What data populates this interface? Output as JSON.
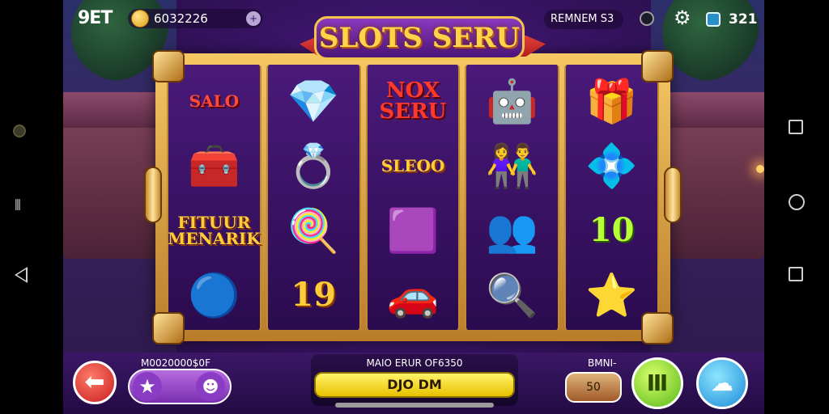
{
  "topbar": {
    "brand": "9ET",
    "balance": "6032226",
    "add": "+",
    "status_text": "REMNEM S3",
    "counter": "321"
  },
  "title": "SLOTS SERU",
  "reels": [
    [
      {
        "kind": "text",
        "text": "SALO",
        "style": "red",
        "name": "character-boy-symbol"
      },
      {
        "kind": "icon",
        "icon": "treasure-chest-icon",
        "glyph": "🧰"
      },
      {
        "kind": "text",
        "text": "FITUUR\nMENARIK",
        "style": "gold",
        "name": "fitur-menarik-symbol"
      },
      {
        "kind": "icon",
        "icon": "blue-orb-icon",
        "glyph": "🔵"
      }
    ],
    [
      {
        "kind": "icon",
        "icon": "blue-gem-icon",
        "glyph": "💎"
      },
      {
        "kind": "icon",
        "icon": "gold-ring-icon",
        "glyph": "💍"
      },
      {
        "kind": "icon",
        "icon": "lollipop-icon",
        "glyph": "🍭"
      },
      {
        "kind": "text",
        "text": "19",
        "style": "gold big",
        "name": "number-19-symbol"
      }
    ],
    [
      {
        "kind": "text",
        "text": "NOX\nSERU",
        "style": "redgold",
        "name": "nox-seru-symbol"
      },
      {
        "kind": "text",
        "text": "SLEOO",
        "style": "gold",
        "name": "sleoo-bonus-symbol"
      },
      {
        "kind": "icon",
        "icon": "purple-gem-icon",
        "glyph": "🟪"
      },
      {
        "kind": "icon",
        "icon": "toy-car-icon",
        "glyph": "🚗"
      }
    ],
    [
      {
        "kind": "icon",
        "icon": "robot-mascot-icon",
        "glyph": "🤖"
      },
      {
        "kind": "icon",
        "icon": "wild-twins-icon",
        "glyph": "👫"
      },
      {
        "kind": "icon",
        "icon": "twins-icon",
        "glyph": "👥"
      },
      {
        "kind": "icon",
        "icon": "magnifier-icon",
        "glyph": "🔍"
      }
    ],
    [
      {
        "kind": "icon",
        "icon": "gold-box-icon",
        "glyph": "🎁"
      },
      {
        "kind": "icon",
        "icon": "pink-gem-icon",
        "glyph": "💠"
      },
      {
        "kind": "text",
        "text": "10",
        "style": "green big",
        "name": "number-10-symbol"
      },
      {
        "kind": "icon",
        "icon": "star-wand-icon",
        "glyph": "⭐"
      }
    ]
  ],
  "bottom": {
    "left_label": "M0020000$0F",
    "spin_label": "MAIO ERUR OF6350",
    "spin_button": "DJO DM",
    "bet_label": "BMNI-",
    "bet_value": "50"
  },
  "colors": {
    "accent": "#ffcc3a",
    "frame": "#c48a33",
    "spin": "#f2d51a"
  }
}
